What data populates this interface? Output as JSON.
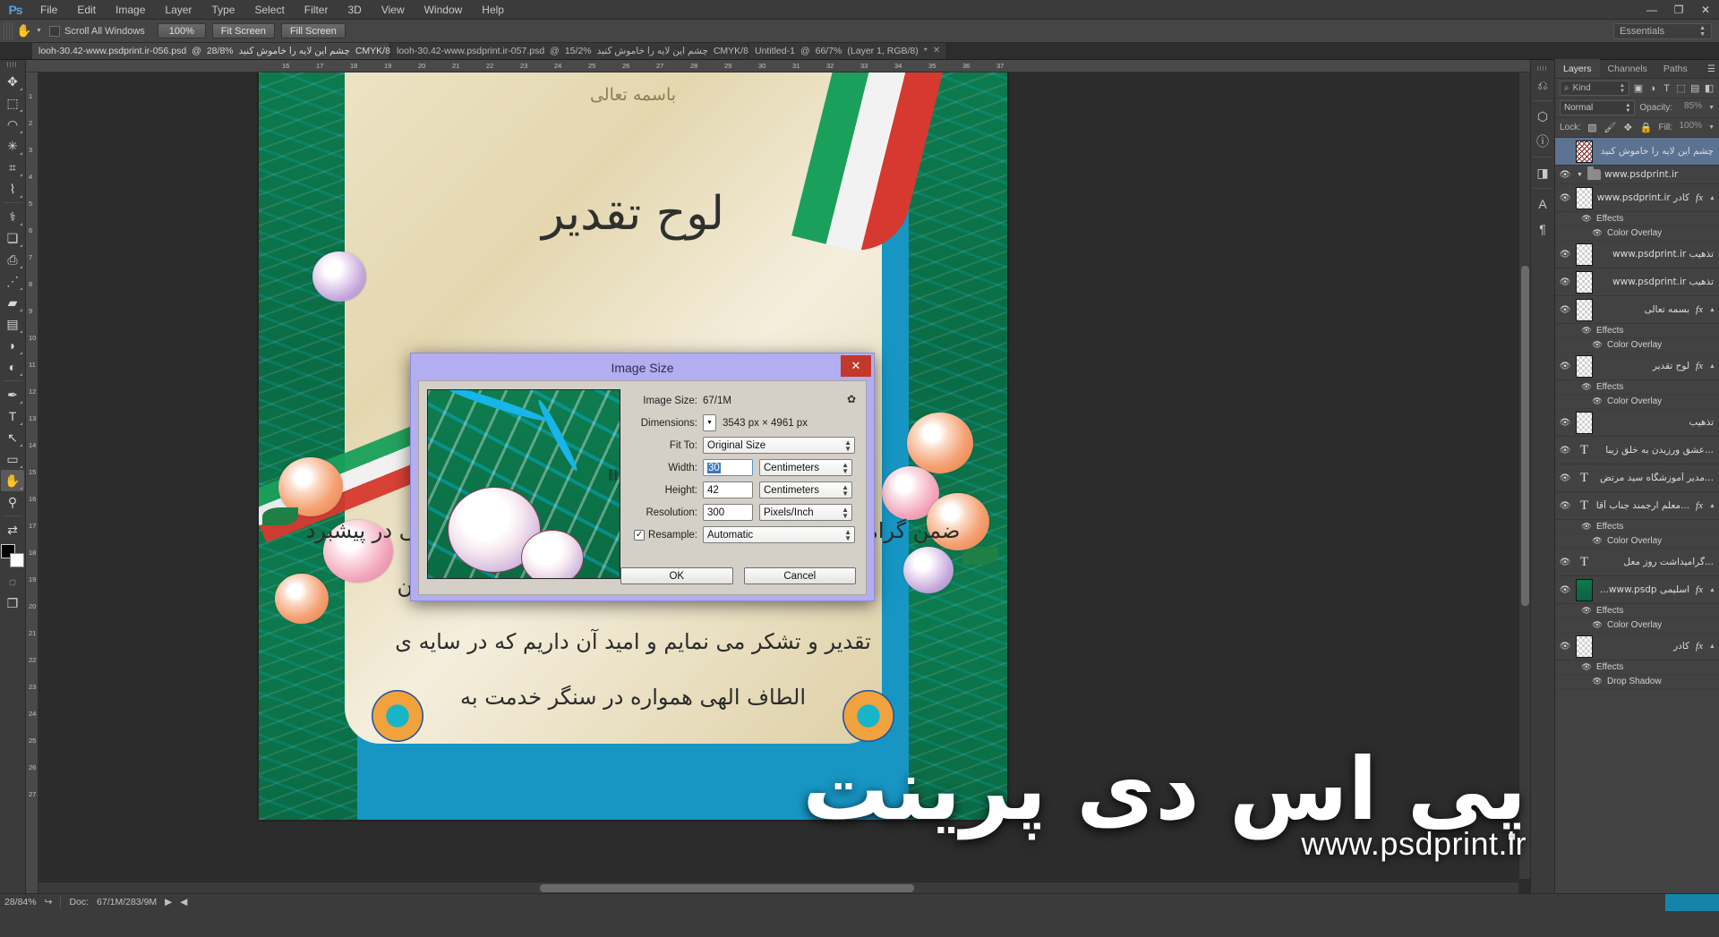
{
  "app": {
    "name": "Ps",
    "logo_color": "#5c9fd8"
  },
  "titlebar": {
    "menus": [
      "File",
      "Edit",
      "Image",
      "Layer",
      "Type",
      "Select",
      "Filter",
      "3D",
      "View",
      "Window",
      "Help"
    ],
    "minimize": "—",
    "restore": "❐",
    "close": "✕"
  },
  "options_bar": {
    "tool_icon": "hand-tool",
    "scroll_all_windows_label": "Scroll All Windows",
    "buttons": [
      "100%",
      "Fit Screen",
      "Fill Screen"
    ],
    "workspace": "Essentials"
  },
  "tabs": [
    {
      "title": "looh-30.42-www.psdprint.ir-056.psd",
      "zoom": "28/8%",
      "farsi": "چشم این لایه  را خاموش کنید",
      "mode": "CMYK/8",
      "dirty": "*",
      "active": true
    },
    {
      "title": "looh-30.42-www.psdprint.ir-057.psd",
      "zoom": "15/2%",
      "farsi": "چشم این لایه  را خاموش کنید",
      "mode": "CMYK/8",
      "dirty": "",
      "active": false
    },
    {
      "title": "Untitled-1",
      "zoom": "66/7%",
      "farsi": "",
      "mode": "Layer 1, RGB/8",
      "dirty": "*",
      "active": false
    }
  ],
  "toolbox": {
    "tools": [
      {
        "name": "move-tool",
        "glyph": "✥"
      },
      {
        "name": "rectangular-marquee-tool",
        "glyph": "▭"
      },
      {
        "name": "lasso-tool",
        "glyph": "◯"
      },
      {
        "name": "magic-wand-tool",
        "glyph": "✸"
      },
      {
        "name": "crop-tool",
        "glyph": "⌗"
      },
      {
        "name": "eyedropper-tool",
        "glyph": "✎"
      },
      {
        "name": "spot-healing-brush-tool",
        "glyph": "⌁"
      },
      {
        "name": "brush-tool",
        "glyph": "🖌"
      },
      {
        "name": "clone-stamp-tool",
        "glyph": "⎙"
      },
      {
        "name": "history-brush-tool",
        "glyph": "✏"
      },
      {
        "name": "eraser-tool",
        "glyph": "▰"
      },
      {
        "name": "gradient-tool",
        "glyph": "▬"
      },
      {
        "name": "blur-tool",
        "glyph": "💧"
      },
      {
        "name": "dodge-tool",
        "glyph": "🔍"
      },
      {
        "name": "pen-tool",
        "glyph": "✒"
      },
      {
        "name": "type-tool",
        "glyph": "T"
      },
      {
        "name": "path-selection-tool",
        "glyph": "↖"
      },
      {
        "name": "rectangle-tool",
        "glyph": "▭"
      },
      {
        "name": "hand-tool",
        "glyph": "✋",
        "selected": true
      },
      {
        "name": "zoom-tool",
        "glyph": "🔎"
      }
    ],
    "foreground_color": "#000000",
    "background_color": "#ffffff"
  },
  "rulers": {
    "horizontal": [
      "16",
      "17",
      "18",
      "19",
      "20",
      "21",
      "22",
      "23",
      "24",
      "25",
      "26",
      "27",
      "28",
      "29",
      "30",
      "31",
      "32",
      "33",
      "34",
      "35",
      "36",
      "37"
    ],
    "vertical": [
      "1",
      "2",
      "3",
      "4",
      "5",
      "6",
      "7",
      "8",
      "9",
      "10",
      "11",
      "12",
      "13",
      "14",
      "15",
      "16",
      "17",
      "18",
      "19",
      "20",
      "21",
      "22",
      "23",
      "24",
      "25",
      "26",
      "27"
    ]
  },
  "canvas": {
    "watermark_farsi": "پی اس دی پرینت",
    "watermark_url": "www.psdprint.ir",
    "artwork_lines": [
      "ضمن گرامیداشت روز معلم به این وسیله از زحمات جناب عالی در پیشبرد",
      "اهداف و پیگیری امور آموزشی و پرورشی این دبستان",
      "تقدیر و تشکر می نمایم و امید آن داریم که در سایه ی",
      "الطاف الهی همواره در سنگر خدمت به"
    ],
    "artwork_title": "لوح تقدیر",
    "artwork_header": "باسمه تعالی"
  },
  "dialog": {
    "title": "Image Size",
    "close_glyph": "✕",
    "gear_glyph": "✿",
    "image_size_label": "Image Size:",
    "image_size_value": "67/1M",
    "dimensions_label": "Dimensions:",
    "dimensions_value": "3543 px  ×  4961 px",
    "fit_to_label": "Fit To:",
    "fit_to_value": "Original Size",
    "width_label": "Width:",
    "width_value": "30",
    "width_unit": "Centimeters",
    "height_label": "Height:",
    "height_value": "42",
    "height_unit": "Centimeters",
    "resolution_label": "Resolution:",
    "resolution_value": "300",
    "resolution_unit": "Pixels/Inch",
    "resample_label": "Resample:",
    "resample_value": "Automatic",
    "resample_checked": "✓",
    "link_glyph": "⛓",
    "ok_label": "OK",
    "cancel_label": "Cancel"
  },
  "layers_panel": {
    "tabs": [
      "Layers",
      "Channels",
      "Paths"
    ],
    "active_tab": "Layers",
    "menu_glyph": "☰",
    "filter_kind": "Kind",
    "filter_icons": [
      "pixel-filter-icon",
      "adjustment-filter-icon",
      "type-filter-icon",
      "shape-filter-icon",
      "smartobject-filter-icon"
    ],
    "blend_mode": "Normal",
    "opacity_label": "Opacity:",
    "opacity_value": "85%",
    "lock_label": "Lock:",
    "fill_label": "Fill:",
    "fill_value": "100%",
    "lock_icons": [
      "lock-transparent-icon",
      "lock-image-icon",
      "lock-position-icon",
      "lock-all-icon"
    ],
    "rows": [
      {
        "kind": "layer",
        "name": "چشم این لایه  را خاموش کنید",
        "rtl": true,
        "visible": false,
        "selected": true,
        "thumb": "art",
        "fx": false
      },
      {
        "kind": "group",
        "name": "www.psdprint.ir",
        "rtl": false,
        "visible": true,
        "expanded": true
      },
      {
        "kind": "layer",
        "name": "کادر www.psdprint.ir",
        "rtl": true,
        "visible": true,
        "thumb": "empty",
        "fx": true,
        "effects": {
          "label": "Effects",
          "items": [
            "Color Overlay"
          ]
        }
      },
      {
        "kind": "layer",
        "name": "تذهیب www.psdprint.ir",
        "rtl": true,
        "visible": true,
        "thumb": "empty",
        "fx": false
      },
      {
        "kind": "layer",
        "name": "تذهیب www.psdprint.ir",
        "rtl": true,
        "visible": true,
        "thumb": "empty",
        "fx": false
      },
      {
        "kind": "layer",
        "name": "بسمه تعالی",
        "rtl": true,
        "visible": true,
        "thumb": "empty",
        "fx": true,
        "effects": {
          "label": "Effects",
          "items": [
            "Color Overlay"
          ]
        }
      },
      {
        "kind": "layer",
        "name": "لوح تقدیر",
        "rtl": true,
        "visible": true,
        "thumb": "empty",
        "fx": true,
        "effects": {
          "label": "Effects",
          "items": [
            "Color Overlay"
          ]
        }
      },
      {
        "kind": "layer",
        "name": "تذهیب",
        "rtl": true,
        "visible": true,
        "thumb": "empty",
        "fx": false
      },
      {
        "kind": "text",
        "name": "...عشق ورزیدن به خلق زیبا",
        "rtl": true,
        "visible": true,
        "fx": false
      },
      {
        "kind": "text",
        "name": "...مدیر آموزشگاه سید مرتض",
        "rtl": true,
        "visible": true,
        "fx": false
      },
      {
        "kind": "text",
        "name": "...معلم ارجمند جناب آقا",
        "rtl": true,
        "visible": true,
        "fx": true,
        "effects": {
          "label": "Effects",
          "items": [
            "Color Overlay"
          ]
        }
      },
      {
        "kind": "text",
        "name": "...گرامیداشت روز معل",
        "rtl": true,
        "visible": true,
        "fx": false
      },
      {
        "kind": "layer",
        "name": "اسلیمی www.psdp...",
        "rtl": true,
        "visible": true,
        "thumb": "tile",
        "fx": true,
        "effects": {
          "label": "Effects",
          "items": [
            "Color Overlay"
          ]
        }
      },
      {
        "kind": "layer",
        "name": "کادر",
        "rtl": true,
        "visible": true,
        "thumb": "empty",
        "fx": true,
        "effects": {
          "label": "Effects",
          "items": [
            "Drop Shadow"
          ]
        }
      }
    ]
  },
  "icon_rail": {
    "icons": [
      "history-icon",
      "3d-icon",
      "info-icon",
      "layer-comps-icon",
      "character-icon",
      "paragraph-icon"
    ]
  },
  "statusbar": {
    "zoom": "28/84%",
    "share_glyph": "↪",
    "doc_label": "Doc:",
    "doc_value": "67/1M/283/9M",
    "play_glyph": "▶",
    "prev_glyph": "◀"
  }
}
